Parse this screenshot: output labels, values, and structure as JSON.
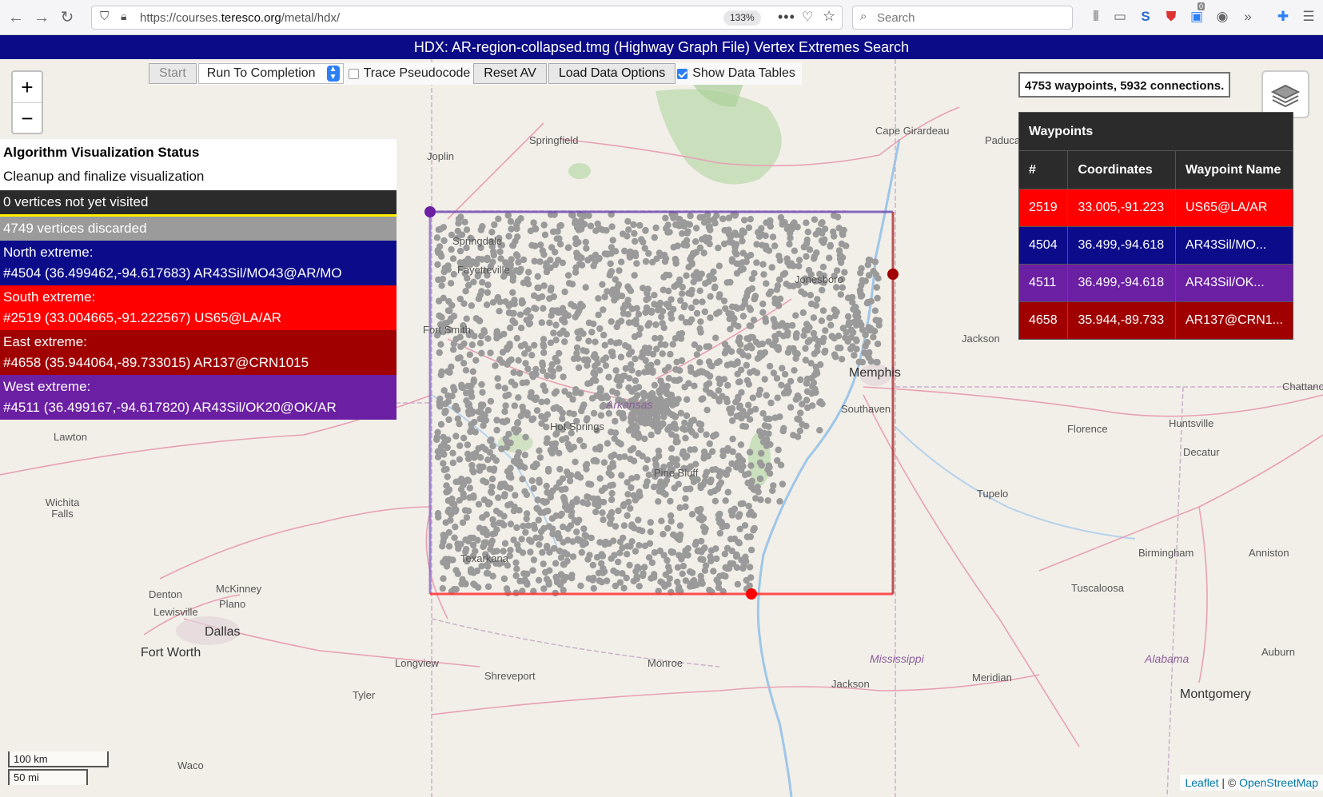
{
  "browser": {
    "url_prefix": "https://courses.",
    "url_domain": "teresco.org",
    "url_path": "/metal/hdx/",
    "zoom": "133%",
    "search_placeholder": "Search",
    "icons": [
      "back-icon",
      "forward-icon",
      "reload-icon",
      "shield-icon",
      "lock-icon",
      "more-icon",
      "pocket-icon",
      "star-icon",
      "search-icon",
      "library-icon",
      "sidebar-icon",
      "extension-icon",
      "shield-extension-icon",
      "notification-icon",
      "account-icon",
      "overflow-icon",
      "puzzle-icon",
      "menu-icon"
    ],
    "notification_count": "0"
  },
  "app": {
    "title": "HDX: AR-region-collapsed.tmg (Highway Graph File) Vertex Extremes Search"
  },
  "toolbar": {
    "start_label": "Start",
    "run_option": "Run To Completion",
    "trace_label": "Trace Pseudocode",
    "trace_checked": false,
    "reset_label": "Reset AV",
    "load_label": "Load Data Options",
    "show_tables_label": "Show Data Tables",
    "show_tables_checked": true
  },
  "zoom": {
    "in": "+",
    "out": "−"
  },
  "status": {
    "heading": "Algorithm Visualization Status",
    "message": "Cleanup and finalize visualization",
    "not_visited": "0 vertices not yet visited",
    "discarded": "4749 vertices discarded",
    "north_label": "North extreme:",
    "north_value": "#4504 (36.499462,-94.617683) AR43Sil/MO43@AR/MO",
    "south_label": "South extreme:",
    "south_value": "#2519 (33.004665,-91.222567) US65@LA/AR",
    "east_label": "East extreme:",
    "east_value": "#4658 (35.944064,-89.733015) AR137@CRN1015",
    "west_label": "West extreme:",
    "west_value": "#4511 (36.499167,-94.617820) AR43Sil/OK20@OK/AR"
  },
  "counts": "4753 waypoints, 5932 connections.",
  "waypoints": {
    "caption": "Waypoints",
    "columns": [
      "#",
      "Coordinates",
      "Waypoint Name"
    ],
    "rows": [
      {
        "num": "2519",
        "coords": "33.005,-91.223",
        "name": "US65@LA/AR",
        "color": "#ff0000"
      },
      {
        "num": "4504",
        "coords": "36.499,-94.618",
        "name": "AR43Sil/MO...",
        "color": "#0c0c8a"
      },
      {
        "num": "4511",
        "coords": "36.499,-94.618",
        "name": "AR43Sil/OK...",
        "color": "#6b1fa3"
      },
      {
        "num": "4658",
        "coords": "35.944,-89.733",
        "name": "AR137@CRN1...",
        "color": "#a00000"
      }
    ]
  },
  "map": {
    "cities": [
      "Springfield",
      "Joplin",
      "Cape Girardeau",
      "Paducah",
      "Jackson",
      "Memphis",
      "Southaven",
      "Florence",
      "Huntsville",
      "Decatur",
      "Chattanooga",
      "Tupelo",
      "Lawton",
      "Wichita Falls",
      "Denton",
      "McKinney",
      "Lewisville",
      "Plano",
      "Dallas",
      "Fort Worth",
      "Waco",
      "Tyler",
      "Longview",
      "Shreveport",
      "Monroe",
      "Jackson",
      "Meridian",
      "Tuscaloosa",
      "Birmingham",
      "Anniston",
      "Auburn",
      "Montgomery",
      "Texarkana",
      "Hot Springs",
      "Fayetteville",
      "Fort Smith",
      "Jonesboro",
      "Pine Bluff",
      "Springdale"
    ],
    "states": [
      "Mississippi",
      "Alabama",
      "Arkansas"
    ],
    "extreme_colors": {
      "north": "#0c0c8a",
      "south": "#ff0000",
      "east": "#a00000",
      "west": "#6b1fa3"
    }
  },
  "scale": {
    "km": "100 km",
    "mi": "50 mi"
  },
  "attribution": {
    "leaflet": "Leaflet",
    "sep": " | © ",
    "osm": "OpenStreetMap"
  }
}
